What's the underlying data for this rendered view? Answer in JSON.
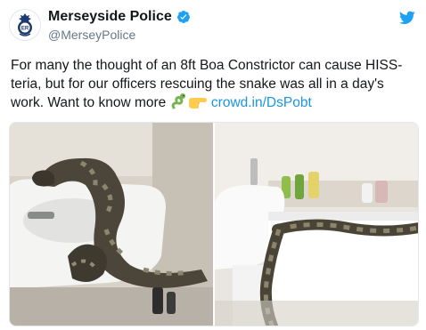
{
  "tweet": {
    "display_name": "Merseyside Police",
    "handle": "@MerseyPolice",
    "text_main": "For many the thought of an 8ft Boa Constrictor can cause HISS-teria, but for our officers rescuing the snake was all in a day's work. Want to know more ",
    "link_text": "crowd.in/DsPobt",
    "emojis": [
      "snake-emoji",
      "pointing-right-emoji"
    ],
    "media": [
      {
        "name": "snake-on-sink-photo"
      },
      {
        "name": "snake-along-bath-photo"
      }
    ]
  },
  "colors": {
    "link": "#1b95e0",
    "verified": "#1da1f2",
    "twitter_bird": "#1da1f2",
    "text": "#14171a",
    "muted": "#657786"
  }
}
